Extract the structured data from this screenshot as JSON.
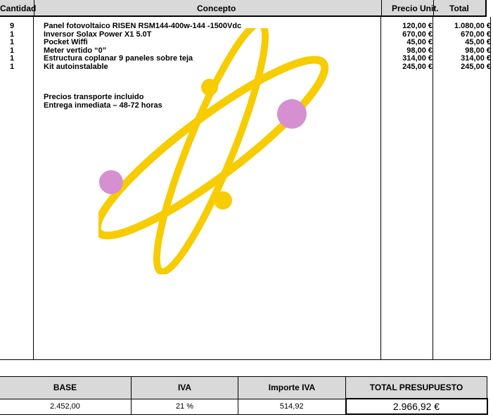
{
  "table": {
    "headers": {
      "quantity": "Cantidad",
      "concept": "Concepto",
      "unit_price": "Precio Unit.",
      "total": "Total"
    },
    "rows": [
      {
        "quantity": "9",
        "concept": "Panel fotovoltaico RISEN RSM144-400w-144 -1500Vdc",
        "unit_price": "120,00 €",
        "total": "1.080,00 €"
      },
      {
        "quantity": "1",
        "concept": "Inversor Solax Power X1 5.0T",
        "unit_price": "670,00 €",
        "total": "670,00 €"
      },
      {
        "quantity": "1",
        "concept": "Pocket Wiffi",
        "unit_price": "45,00 €",
        "total": "45,00 €"
      },
      {
        "quantity": "1",
        "concept": "Meter vertido “0”",
        "unit_price": "98,00 €",
        "total": "98,00 €"
      },
      {
        "quantity": "1",
        "concept": "Estructura coplanar 9 paneles sobre teja",
        "unit_price": "314,00 €",
        "total": "314,00 €"
      },
      {
        "quantity": "1",
        "concept": "Kit autoinstalable",
        "unit_price": "245,00 €",
        "total": "245,00 €"
      }
    ],
    "notes": [
      "Precios transporte incluido",
      "Entrega inmediata – 48-72 horas"
    ]
  },
  "summary": {
    "headers": {
      "base": "BASE",
      "iva": "IVA",
      "iva_amount": "Importe IVA",
      "total": "TOTAL PRESUPUESTO"
    },
    "values": {
      "base": "2.452,00",
      "iva": "21 %",
      "iva_amount": "514,92",
      "total": "2.966,92 €"
    }
  },
  "colors": {
    "header_bg": "#d9d9d9",
    "atom_orbit": "#f7cc00",
    "atom_electron_pink": "#d68fd0"
  },
  "logo": {
    "icon": "atom-icon"
  }
}
